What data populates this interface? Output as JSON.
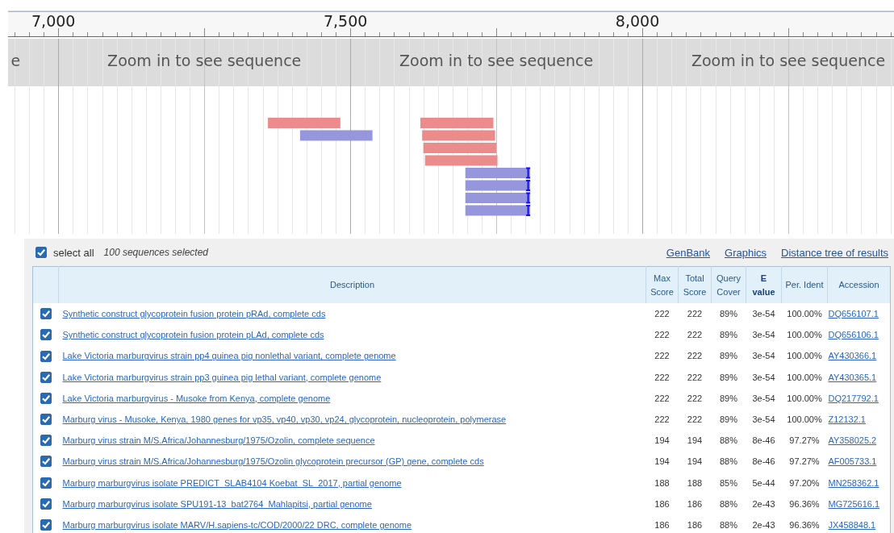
{
  "viewer": {
    "ruler_ticks": [
      "7,000",
      "7,500",
      "8,000"
    ],
    "band_labels": [
      "e",
      "Zoom in to see sequence",
      "Zoom in to see sequence",
      "Zoom in to see sequence"
    ],
    "hits": [
      {
        "color": "#ec8b8b",
        "end_mark": false
      },
      {
        "color": "#9596dc",
        "end_mark": false
      },
      {
        "color": "#ec8b8b",
        "end_mark": false
      },
      {
        "color": "#ec8b8b",
        "end_mark": false
      },
      {
        "color": "#ec8b8b",
        "end_mark": false
      },
      {
        "color": "#ec8b8b",
        "end_mark": false
      },
      {
        "color": "#9596dc",
        "end_mark": true
      },
      {
        "color": "#9596dc",
        "end_mark": true
      },
      {
        "color": "#9596dc",
        "end_mark": true
      },
      {
        "color": "#9596dc",
        "end_mark": true
      }
    ]
  },
  "results": {
    "select_all": {
      "label": "select all",
      "checked": true
    },
    "selection_count": "100 sequences selected",
    "links": [
      "GenBank",
      "Graphics",
      "Distance tree of results"
    ],
    "columns": [
      {
        "label": "Description",
        "sorted": false
      },
      {
        "label": "Max Score",
        "sorted": false
      },
      {
        "label": "Total Score",
        "sorted": false
      },
      {
        "label": "Query Cover",
        "sorted": false
      },
      {
        "label": "E value",
        "sorted": true
      },
      {
        "label": "Per. Ident",
        "sorted": false
      },
      {
        "label": "Accession",
        "sorted": false
      }
    ],
    "rows": [
      {
        "checked": true,
        "description": "Synthetic construct glycoprotein fusion protein pRAd, complete cds",
        "max_score": "222",
        "total_score": "222",
        "query_cover": "89%",
        "e_value": "3e-54",
        "per_ident": "100.00%",
        "accession": "DQ656107.1"
      },
      {
        "checked": true,
        "description": "Synthetic construct glycoprotein fusion protein pLAd, complete cds",
        "max_score": "222",
        "total_score": "222",
        "query_cover": "89%",
        "e_value": "3e-54",
        "per_ident": "100.00%",
        "accession": "DQ656106.1"
      },
      {
        "checked": true,
        "description": "Lake Victoria marburgvirus strain pp4 guinea pig nonlethal variant, complete genome",
        "max_score": "222",
        "total_score": "222",
        "query_cover": "89%",
        "e_value": "3e-54",
        "per_ident": "100.00%",
        "accession": "AY430366.1"
      },
      {
        "checked": true,
        "description": "Lake Victoria marburgvirus strain pp3 guinea pig lethal variant, complete genome",
        "max_score": "222",
        "total_score": "222",
        "query_cover": "89%",
        "e_value": "3e-54",
        "per_ident": "100.00%",
        "accession": "AY430365.1"
      },
      {
        "checked": true,
        "description": "Lake Victoria marburgvirus - Musoke from Kenya, complete genome",
        "max_score": "222",
        "total_score": "222",
        "query_cover": "89%",
        "e_value": "3e-54",
        "per_ident": "100.00%",
        "accession": "DQ217792.1"
      },
      {
        "checked": true,
        "description": "Marburg virus - Musoke, Kenya, 1980 genes for vp35, vp40, vp30, vp24, glycoprotein, nucleoprotein, polymerase",
        "max_score": "222",
        "total_score": "222",
        "query_cover": "89%",
        "e_value": "3e-54",
        "per_ident": "100.00%",
        "accession": "Z12132.1"
      },
      {
        "checked": true,
        "description": "Marburg virus strain M/S.Africa/Johannesburg/1975/Ozolin, complete sequence",
        "max_score": "194",
        "total_score": "194",
        "query_cover": "88%",
        "e_value": "8e-46",
        "per_ident": "97.27%",
        "accession": "AY358025.2"
      },
      {
        "checked": true,
        "description": "Marburg virus strain M/S.Africa/Johannesburg/1975/Ozolin glycoprotein precursor (GP) gene, complete cds",
        "max_score": "194",
        "total_score": "194",
        "query_cover": "88%",
        "e_value": "8e-46",
        "per_ident": "97.27%",
        "accession": "AF005733.1"
      },
      {
        "checked": true,
        "description": "Marburg marburgvirus isolate PREDICT_SLAB4104 Koebat_SL_2017, partial genome",
        "max_score": "188",
        "total_score": "188",
        "query_cover": "85%",
        "e_value": "5e-44",
        "per_ident": "97.20%",
        "accession": "MN258362.1"
      },
      {
        "checked": true,
        "description": "Marburg marburgvirus isolate SPU191-13_bat2764_Mahlapitsi, partial genome",
        "max_score": "186",
        "total_score": "186",
        "query_cover": "88%",
        "e_value": "2e-43",
        "per_ident": "96.36%",
        "accession": "MG725616.1"
      },
      {
        "checked": true,
        "description": "Marburg marburgvirus isolate MARV/H.sapiens-tc/COD/2000/22 DRC, complete genome",
        "max_score": "186",
        "total_score": "186",
        "query_cover": "88%",
        "e_value": "2e-43",
        "per_ident": "96.36%",
        "accession": "JX458848.1"
      }
    ]
  }
}
